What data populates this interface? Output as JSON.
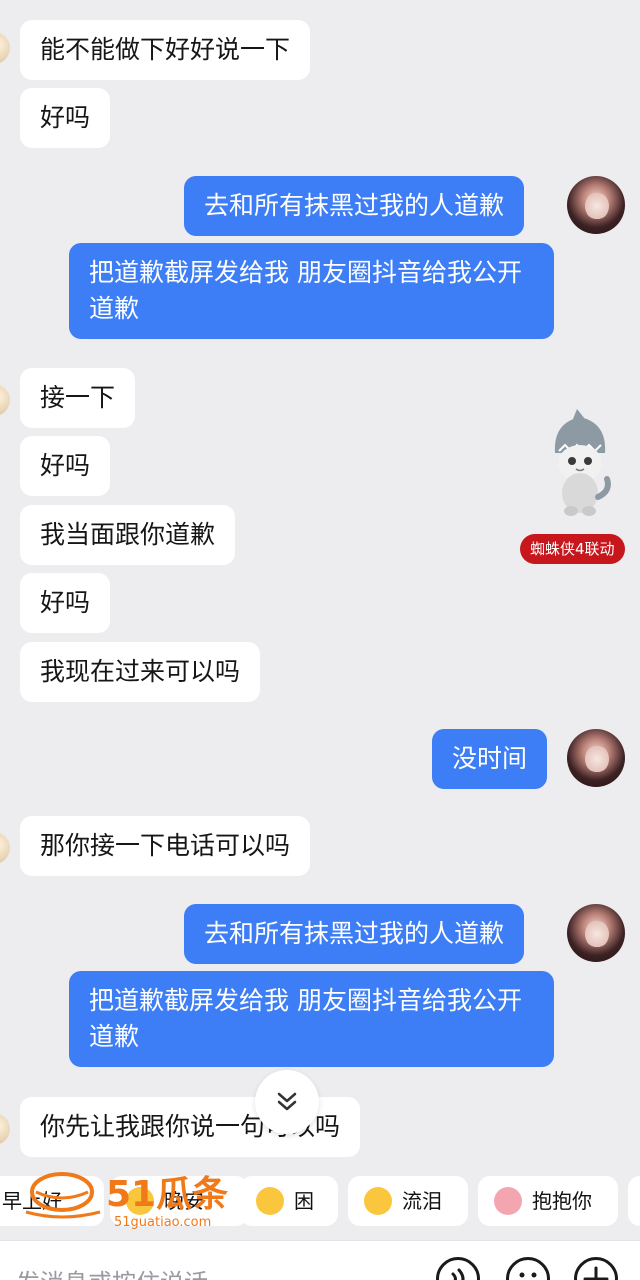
{
  "messages": [
    {
      "side": "in",
      "text": "能不能做下好好说一下"
    },
    {
      "side": "in",
      "text": "好吗"
    },
    {
      "side": "out",
      "text": "去和所有抹黑过我的人道歉"
    },
    {
      "side": "out",
      "text": "把道歉截屏发给我 朋友圈抖音给我公开道歉"
    },
    {
      "side": "in",
      "text": "接一下"
    },
    {
      "side": "in",
      "text": "好吗"
    },
    {
      "side": "in",
      "text": "我当面跟你道歉"
    },
    {
      "side": "in",
      "text": "好吗"
    },
    {
      "side": "in",
      "text": "我现在过来可以吗"
    },
    {
      "side": "out",
      "text": "没时间"
    },
    {
      "side": "in",
      "text": "那你接一下电话可以吗"
    },
    {
      "side": "out",
      "text": "去和所有抹黑过我的人道歉"
    },
    {
      "side": "out",
      "text": "把道歉截屏发给我 朋友圈抖音给我公开道歉"
    },
    {
      "side": "in",
      "text": "你先让我跟你说一句可以吗"
    }
  ],
  "promo": {
    "badge": "蜘蛛侠4联动"
  },
  "quick_replies": [
    {
      "label": "早上好"
    },
    {
      "label": "晚安"
    },
    {
      "label": "困"
    },
    {
      "label": "流泪"
    },
    {
      "label": "抱抱你"
    }
  ],
  "watermark": {
    "brand": "51瓜条",
    "site": "51guatiao.com"
  },
  "input": {
    "placeholder": "发消息或按住说话"
  },
  "colors": {
    "outgoing": "#3d7ef6",
    "incoming": "#ffffff",
    "background": "#ededf0",
    "badge": "#c8161d",
    "logo": "#f07a1a"
  }
}
